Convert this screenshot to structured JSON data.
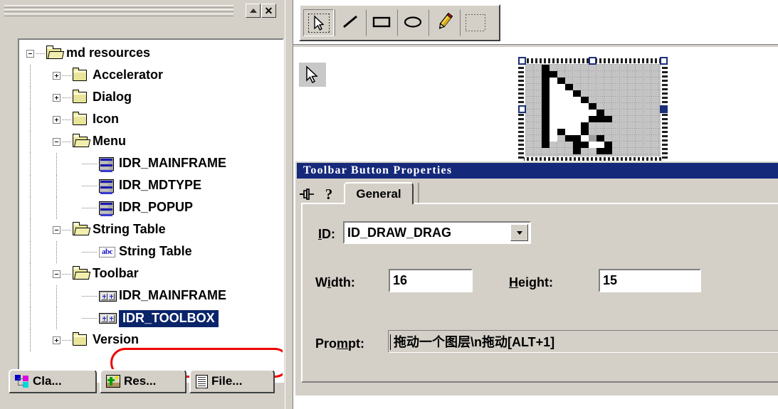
{
  "workspace": {
    "pane_title": "",
    "buttons": [
      {
        "name": "roll-up",
        "glyph": "▲"
      },
      {
        "name": "close",
        "glyph": "✕"
      }
    ],
    "tree": [
      {
        "label": "md resources",
        "level": 0,
        "toggle": "minus",
        "icon": "folder-open"
      },
      {
        "label": "Accelerator",
        "level": 1,
        "toggle": "plus",
        "icon": "folder-closed"
      },
      {
        "label": "Dialog",
        "level": 1,
        "toggle": "plus",
        "icon": "folder-closed"
      },
      {
        "label": "Icon",
        "level": 1,
        "toggle": "plus",
        "icon": "folder-closed"
      },
      {
        "label": "Menu",
        "level": 1,
        "toggle": "minus",
        "icon": "folder-open"
      },
      {
        "label": "IDR_MAINFRAME",
        "level": 2,
        "toggle": "none",
        "icon": "menu-resource"
      },
      {
        "label": "IDR_MDTYPE",
        "level": 2,
        "toggle": "none",
        "icon": "menu-resource"
      },
      {
        "label": "IDR_POPUP",
        "level": 2,
        "toggle": "none",
        "icon": "menu-resource"
      },
      {
        "label": "String Table",
        "level": 1,
        "toggle": "minus",
        "icon": "folder-open"
      },
      {
        "label": "String Table",
        "level": 2,
        "toggle": "none",
        "icon": "abc-resource"
      },
      {
        "label": "Toolbar",
        "level": 1,
        "toggle": "minus",
        "icon": "folder-open"
      },
      {
        "label": "IDR_MAINFRAME",
        "level": 2,
        "toggle": "none",
        "icon": "toolbar-resource"
      },
      {
        "label": "IDR_TOOLBOX",
        "level": 2,
        "toggle": "none",
        "icon": "toolbar-resource",
        "selected": true
      },
      {
        "label": "Version",
        "level": 1,
        "toggle": "plus",
        "icon": "folder-closed"
      }
    ],
    "tabs": [
      {
        "label": "Cla...",
        "icon": "class-view-icon",
        "active": false
      },
      {
        "label": "Res...",
        "icon": "resource-view-icon",
        "active": true
      },
      {
        "label": "File...",
        "icon": "file-view-icon",
        "active": false
      }
    ]
  },
  "editor": {
    "toolbar_tools": [
      {
        "name": "select-tool",
        "icon": "arrow-select-icon",
        "pressed": true
      },
      {
        "name": "line-tool",
        "icon": "line-icon",
        "pressed": false
      },
      {
        "name": "rectangle-tool",
        "icon": "rectangle-icon",
        "pressed": false
      },
      {
        "name": "ellipse-tool",
        "icon": "ellipse-icon",
        "pressed": false
      },
      {
        "name": "pencil-tool",
        "icon": "pencil-icon",
        "pressed": false
      },
      {
        "name": "marquee-tool",
        "icon": "dotted-rect-icon",
        "pressed": false
      }
    ],
    "preview_icon": "arrow-cursor-preview"
  },
  "properties_dialog": {
    "title": "Toolbar Button Properties",
    "pin_icon": "pushpin-icon",
    "help_icon": "question-mark-icon",
    "tabs": [
      {
        "label": "General",
        "active": true
      }
    ],
    "fields": {
      "id_label": "ID:",
      "id_value": "ID_DRAW_DRAG",
      "id_dropdown_icon": "chevron-down-icon",
      "width_label": "Width:",
      "width_value": "16",
      "height_label": "Height:",
      "height_value": "15",
      "prompt_label": "Prompt:",
      "prompt_value": "拖动一个图层\\n拖动[ALT+1]"
    }
  },
  "colors": {
    "face": "#d4d0c8",
    "selection_blue": "#0a246a",
    "title_blue": "#15297a",
    "highlight_red": "#ee0000",
    "folder_yellow": "#e8e49a"
  }
}
